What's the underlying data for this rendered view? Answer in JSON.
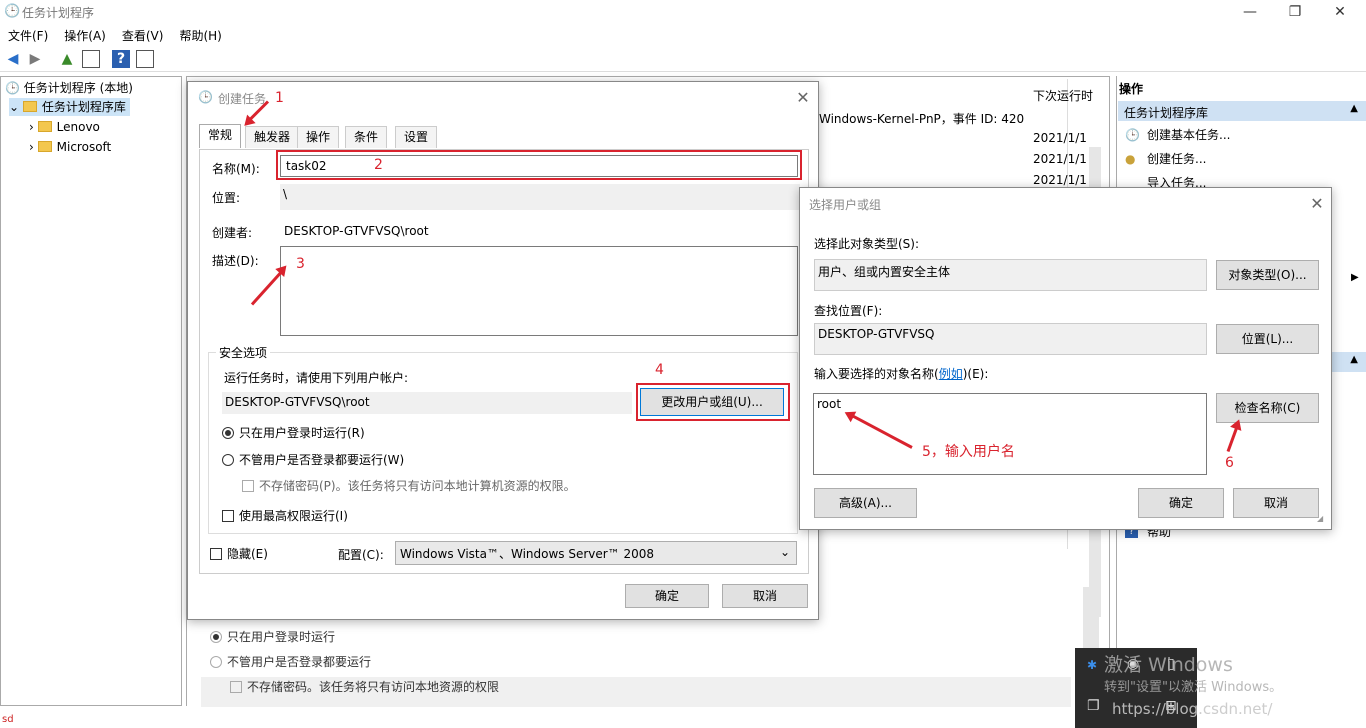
{
  "app": {
    "title": "任务计划程序"
  },
  "menu": [
    "文件(F)",
    "操作(A)",
    "查看(V)",
    "帮助(H)"
  ],
  "tree": {
    "root": "任务计划程序 (本地)",
    "library": "任务计划程序库",
    "children": [
      "Lenovo",
      "Microsoft"
    ]
  },
  "background": {
    "column_header": "下次运行时",
    "event_text": "Windows-Kernel-PnP，事件 ID: 420",
    "dates": [
      "2021/1/1",
      "2021/1/1",
      "2021/1/1"
    ],
    "radio1": "只在用户登录时运行",
    "radio2": "不管用户是否登录都要运行",
    "check": "不存储密码。该任务将只有访问本地资源的权限"
  },
  "actions": {
    "header": "操作",
    "section": "任务计划程序库",
    "items": [
      "创建基本任务...",
      "创建任务...",
      "导入任务..."
    ],
    "help": "帮助"
  },
  "create_task": {
    "title": "创建任务",
    "tabs": [
      "常规",
      "触发器",
      "操作",
      "条件",
      "设置"
    ],
    "name_label": "名称(M):",
    "name_value": "task02",
    "location_label": "位置:",
    "location_value": "\\",
    "author_label": "创建者:",
    "author_value": "DESKTOP-GTVFVSQ\\root",
    "desc_label": "描述(D):",
    "security_title": "安全选项",
    "security_prompt": "运行任务时，请使用下列用户帐户:",
    "user_value": "DESKTOP-GTVFVSQ\\root",
    "change_user_btn": "更改用户或组(U)...",
    "radio_logged_on": "只在用户登录时运行(R)",
    "radio_any": "不管用户是否登录都要运行(W)",
    "no_store_pw": "不存储密码(P)。该任务将只有访问本地计算机资源的权限。",
    "highest_priv": "使用最高权限运行(I)",
    "hidden": "隐藏(E)",
    "config_label": "配置(C):",
    "config_value": "Windows Vista™、Windows Server™ 2008",
    "ok": "确定",
    "cancel": "取消"
  },
  "select_user": {
    "title": "选择用户或组",
    "obj_type_label": "选择此对象类型(S):",
    "obj_type_value": "用户、组或内置安全主体",
    "obj_type_btn": "对象类型(O)...",
    "location_label": "查找位置(F):",
    "location_value": "DESKTOP-GTVFVSQ",
    "location_btn": "位置(L)...",
    "name_label_pre": "输入要选择的对象名称(",
    "name_label_link": "例如",
    "name_label_post": ")(E):",
    "name_value": "root",
    "check_btn": "检查名称(C)",
    "advanced_btn": "高级(A)...",
    "ok": "确定",
    "cancel": "取消"
  },
  "annotations": [
    "1",
    "2",
    "3",
    "4",
    "5，输入用户名",
    "6"
  ],
  "watermark": {
    "line1": "激活 Windows",
    "line2": "转到\"设置\"以激活 Windows。",
    "url": "https://blog.csdn.net/"
  },
  "status": "sd",
  "colors": {
    "annotation": "#d9232e",
    "selection": "#cfe1f3",
    "link": "#0066cc"
  }
}
